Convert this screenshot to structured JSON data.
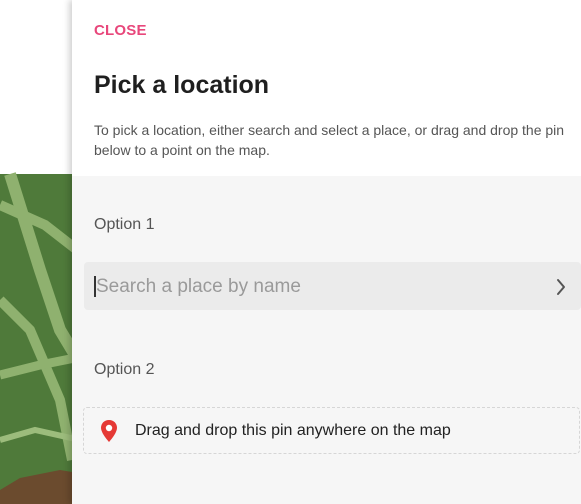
{
  "panel": {
    "close_label": "CLOSE",
    "title": "Pick a location",
    "description": "To pick a location, either search and select a place, or drag and drop the pin below to a point on the map."
  },
  "option1": {
    "label": "Option 1",
    "search_placeholder": "Search a place by name",
    "search_value": ""
  },
  "option2": {
    "label": "Option 2",
    "pin_text": "Drag and drop this pin anywhere on the map"
  },
  "icons": {
    "next": "chevron-right-icon",
    "pin": "map-pin-icon"
  },
  "colors": {
    "accent": "#e8477b",
    "pin": "#e53935",
    "map_green": "#4f7a3a",
    "map_road": "#8fb16f"
  }
}
